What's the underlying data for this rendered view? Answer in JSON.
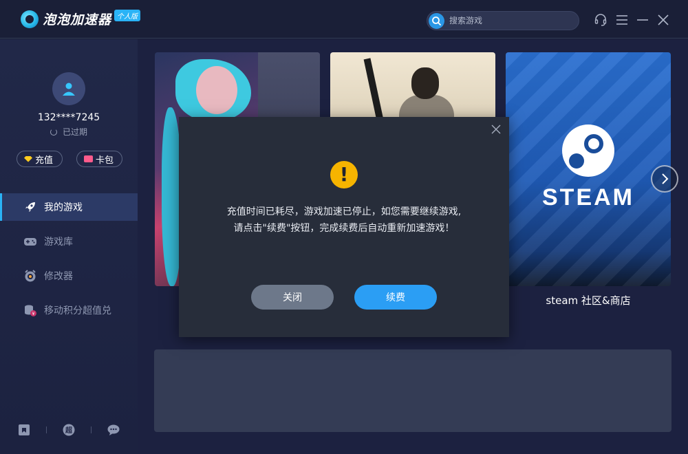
{
  "app": {
    "name": "泡泡加速器",
    "edition_badge": "个人版"
  },
  "search": {
    "placeholder": "搜索游戏"
  },
  "window_controls": [
    "headset-icon",
    "menu-icon",
    "minimize-icon",
    "close-icon"
  ],
  "user": {
    "phone": "132****7245",
    "status": "已过期",
    "recharge_label": "充值",
    "wallet_label": "卡包"
  },
  "sidebar": {
    "items": [
      {
        "label": "我的游戏",
        "icon": "rocket-icon",
        "active": true
      },
      {
        "label": "游戏库",
        "icon": "gamepad-icon",
        "active": false
      },
      {
        "label": "修改器",
        "icon": "modifier-icon",
        "active": false
      },
      {
        "label": "移动积分超值兑",
        "icon": "coins-icon",
        "active": false
      }
    ],
    "footer_icons": [
      "bookmark-icon",
      "super-icon",
      "chat-icon"
    ]
  },
  "games": {
    "cards": [
      {
        "art": "league-of-legends-art"
      },
      {
        "art": "pubg-art"
      },
      {
        "art": "steam-art",
        "logo_text": "STEAM",
        "caption": "steam 社区&商店"
      }
    ]
  },
  "modal": {
    "line1": "充值时间已耗尽，游戏加速已停止，如您需要继续游戏,",
    "line2": "请点击\"续费\"按钮，完成续费后自动重新加速游戏！",
    "close_label": "关闭",
    "renew_label": "续费",
    "warning_glyph": "!"
  },
  "colors": {
    "accent": "#2b9ef4",
    "warning": "#f6b400",
    "sidebar_active": "#2c3a66"
  }
}
